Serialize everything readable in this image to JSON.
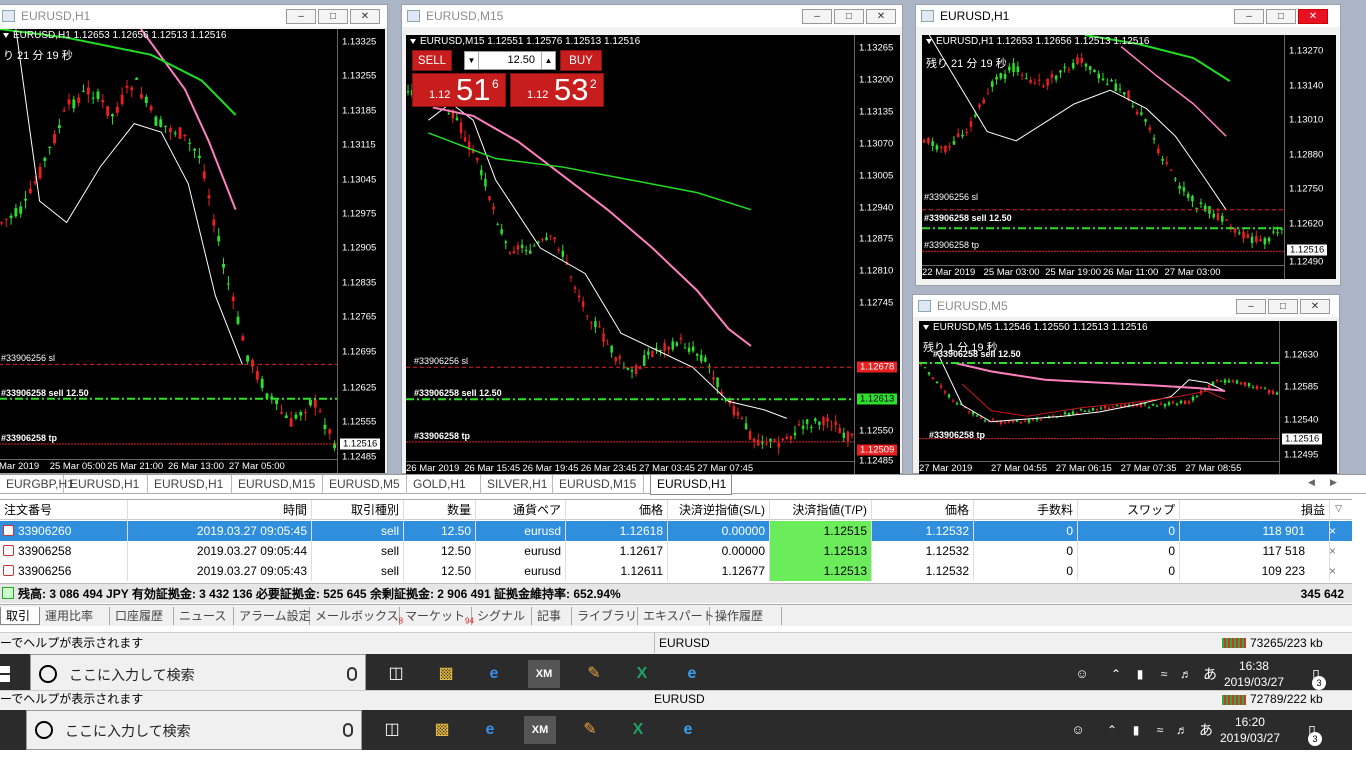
{
  "windows": {
    "w1": {
      "title": "EURUSD,H1",
      "header": "EURUSD,H1  1.12653 1.12656 1.12513 1.12516",
      "remaining": "り 21 分 19 秒",
      "prices": [
        "1.13325",
        "1.13255",
        "1.13185",
        "1.13115",
        "1.13045",
        "1.12975",
        "1.12905",
        "1.12835",
        "1.12765",
        "1.12695",
        "1.12625",
        "1.12555",
        "1.12516",
        "1.12485"
      ],
      "times": [
        "Mar 2019",
        "25 Mar 05:00",
        "25 Mar 21:00",
        "26 Mar 13:00",
        "27 Mar 05:00"
      ],
      "orders": {
        "sl": "#33906256 sl",
        "sell": "#33906258 sell 12.50",
        "tp": "#33906258 tp"
      }
    },
    "w2": {
      "title": "EURUSD,M15",
      "header": "EURUSD,M15  1.12551 1.12576 1.12513 1.12516",
      "prices": [
        "1.13265",
        "1.13200",
        "1.13135",
        "1.13070",
        "1.13005",
        "1.12940",
        "1.12875",
        "1.12810",
        "1.12745",
        "1.12678",
        "1.12613",
        "1.12550",
        "1.12509",
        "1.12485"
      ],
      "times": [
        "26 Mar 2019",
        "26 Mar 15:45",
        "26 Mar 19:45",
        "26 Mar 23:45",
        "27 Mar 03:45",
        "27 Mar 07:45"
      ],
      "orders": {
        "sl": "#33906256 sl",
        "sell": "#33906258 sell 12.50",
        "tp": "#33906258 tp"
      },
      "trade": {
        "sell": "SELL",
        "buy": "BUY",
        "lot": "12.50",
        "sell_small": "1.12",
        "sell_big": "51",
        "sell_sup": "6",
        "buy_small": "1.12",
        "buy_big": "53",
        "buy_sup": "2"
      }
    },
    "w3": {
      "title": "EURUSD,H1",
      "header": "EURUSD,H1  1.12653 1.12656 1.12513 1.12516",
      "remaining": "残り 21 分 19 秒",
      "prices": [
        "1.13270",
        "1.13140",
        "1.13010",
        "1.12880",
        "1.12750",
        "1.12620",
        "1.12516",
        "1.12490"
      ],
      "times": [
        "22 Mar 2019",
        "25 Mar 03:00",
        "25 Mar 19:00",
        "26 Mar 11:00",
        "27 Mar 03:00"
      ],
      "orders": {
        "sl": "#33906256 sl",
        "sell": "#33906258 sell 12.50",
        "tp": "#33906258 tp"
      }
    },
    "w4": {
      "title": "EURUSD,M5",
      "header": "EURUSD,M5  1.12546 1.12550 1.12513 1.12516",
      "remaining": "残り 1 分 19 秒",
      "prices": [
        "1.12630",
        "1.12585",
        "1.12540",
        "1.12516",
        "1.12495"
      ],
      "times": [
        "27 Mar 2019",
        "27 Mar 04:55",
        "27 Mar 06:15",
        "27 Mar 07:35",
        "27 Mar 08:55"
      ],
      "orders": {
        "sell": "#33906258 sell 12.50",
        "tp": "#33906258 tp"
      }
    }
  },
  "chart_tabs": [
    "EURGBP,H1",
    "EURUSD,H1",
    "EURUSD,H1",
    "EURUSD,M15",
    "EURUSD,M5",
    "GOLD,H1",
    "SILVER,H1",
    "EURUSD,M15",
    "EURUSD,H1"
  ],
  "terminal": {
    "headers": [
      "注文番号",
      "時間",
      "取引種別",
      "数量",
      "通貨ペア",
      "価格",
      "決済逆指値(S/L)",
      "決済指値(T/P)",
      "価格",
      "手数料",
      "スワップ",
      "損益"
    ],
    "rows": [
      [
        "33906260",
        "2019.03.27 09:05:45",
        "sell",
        "12.50",
        "eurusd",
        "1.12618",
        "0.00000",
        "1.12515",
        "1.12532",
        "0",
        "0",
        "118 901"
      ],
      [
        "33906258",
        "2019.03.27 09:05:44",
        "sell",
        "12.50",
        "eurusd",
        "1.12617",
        "0.00000",
        "1.12513",
        "1.12532",
        "0",
        "0",
        "117 518"
      ],
      [
        "33906256",
        "2019.03.27 09:05:43",
        "sell",
        "12.50",
        "eurusd",
        "1.12611",
        "1.12677",
        "1.12513",
        "1.12532",
        "0",
        "0",
        "109 223"
      ]
    ],
    "summary": "残高: 3 086 494 JPY  有効証拠金: 3 432 136  必要証拠金: 525 645  余剰証拠金: 2 906 491  証拠金維持率: 652.94%",
    "total": "345 642"
  },
  "bottom_tabs": [
    "取引",
    "運用比率",
    "口座履歴",
    "ニュース",
    "アラーム設定",
    "メールボックス",
    "マーケット",
    "シグナル",
    "記事",
    "ライブラリ",
    "エキスパート",
    "操作履歴"
  ],
  "mailbox_count": "8",
  "market_count": "94",
  "status1": {
    "help": "ーでヘルプが表示されます",
    "symbol": "EURUSD",
    "traffic": "73265/223 kb"
  },
  "status2": {
    "help": "ーでヘルプが表示されます",
    "symbol": "EURUSD",
    "traffic": "72789/222 kb"
  },
  "taskbar1": {
    "search": "ここに入力して検索",
    "time": "16:38",
    "date": "2019/03/27",
    "notif": "3"
  },
  "taskbar2": {
    "search": "ここに入力して検索",
    "time": "16:20",
    "date": "2019/03/27",
    "notif": "3"
  },
  "ime": "あ",
  "colors": {
    "bull": "#2ee02e",
    "bear": "#e82020",
    "ma_fast": "#ffffff",
    "ma_mid": "#ff7fbf",
    "ma_slow": "#22dd22",
    "tp_fill": "#6bed5b",
    "select": "#2f8fdd"
  }
}
